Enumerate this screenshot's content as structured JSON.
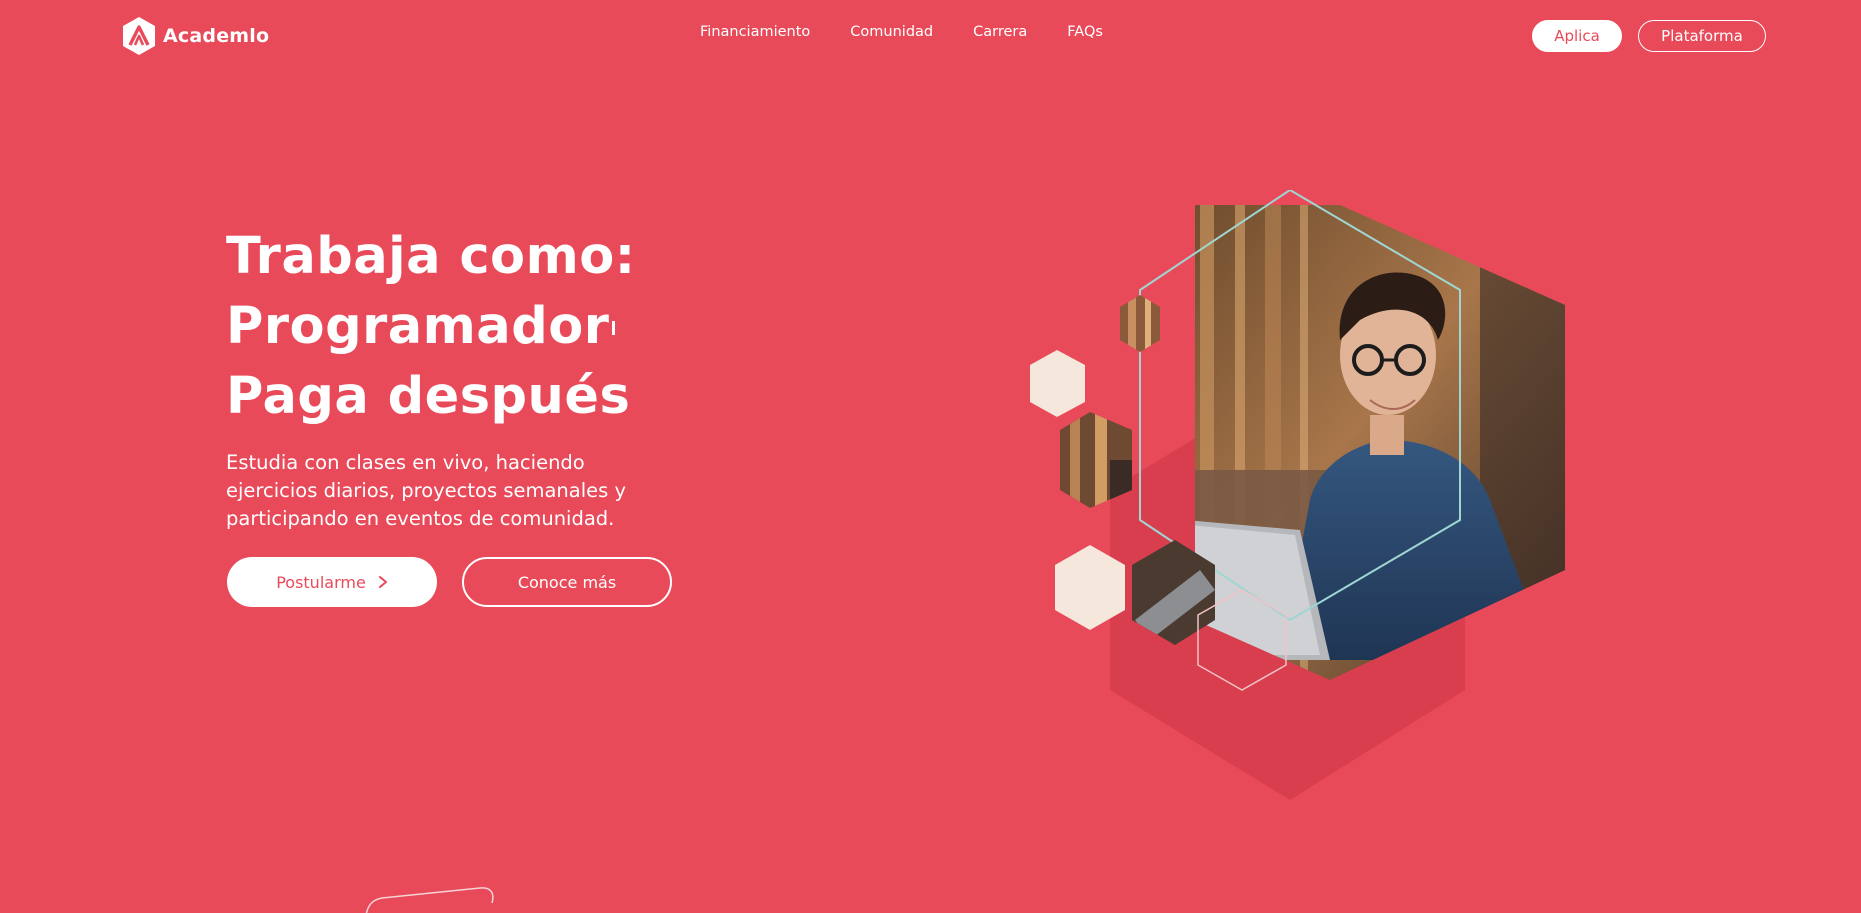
{
  "brand": {
    "name": "Academlo",
    "logo_icon": "academlo-hexagon-logo"
  },
  "nav": {
    "links": [
      "Financiamiento",
      "Comunidad",
      "Carrera",
      "FAQs"
    ],
    "aplica_label": "Aplica",
    "plataforma_label": "Plataforma"
  },
  "hero": {
    "title_lines": [
      "Trabaja como:",
      "Programador",
      "Paga después"
    ],
    "description": "Estudia con clases en vivo, haciendo ejercicios diarios, proyectos semanales y participando en eventos de comunidad.",
    "primary_cta": "Postularme",
    "secondary_cta": "Conoce más",
    "primary_cta_icon": "chevron-right-icon",
    "image_subject": "young man with glasses and denim shirt using a laptop in a cafe"
  },
  "colors": {
    "background": "#e94a5a",
    "accent_dark": "#d93e4e",
    "outline": "#9fd6d2",
    "cream": "#f6e7dd",
    "white": "#ffffff"
  }
}
